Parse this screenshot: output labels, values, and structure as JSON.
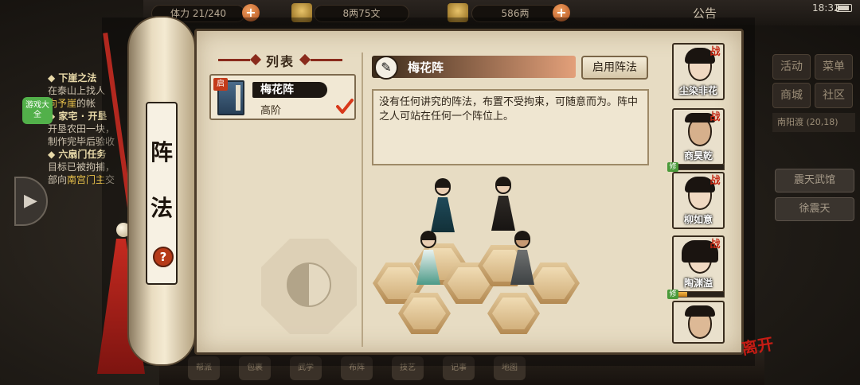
{
  "topbar": {
    "stamina_label": "体力",
    "stamina_value": "21/240",
    "silver": "8两75文",
    "gold": "586两",
    "notice_label": "公告",
    "clock": "18:32"
  },
  "quest_log": {
    "q1_title": "◆ 下崖之法",
    "q1_line1": "在泰山上找人",
    "q1_highlight": "向予崖",
    "q1_suffix": "的帐",
    "q2_title": "◆ 家宅 · 开垦",
    "q2_line1": "开垦农田一块，",
    "q2_line2": "制作完毕后验收",
    "q3_title": "◆ 六扇门任务",
    "q3_line1": "目标已被拘捕，",
    "q3_line2_prefix": "部向",
    "q3_highlight": "南宫门主",
    "q3_suffix": "交",
    "side_tab": "游戏大全"
  },
  "right_menu": {
    "activity": "活动",
    "menu": "菜单",
    "shop": "商城",
    "community": "社区",
    "location": "南阳渡",
    "coords": "(20,18)",
    "npc1": "震天武馆",
    "npc2": "徐震天"
  },
  "scroll": {
    "title_char1": "阵",
    "title_char2": "法",
    "help": "?"
  },
  "formation_list": {
    "header": "列表",
    "item": {
      "badge": "启",
      "name": "梅花阵",
      "rank": "高阶"
    }
  },
  "detail": {
    "name": "梅花阵",
    "enable_button": "启用阵法",
    "description": "没有任何讲究的阵法，布置不受拘束，可随意而为。阵中之人可站在任何一个阵位上。"
  },
  "party": [
    {
      "name": "尘染非花",
      "badge": "战"
    },
    {
      "name": "商昊乾",
      "badge": "战",
      "tag": "修",
      "progress": 0.12
    },
    {
      "name": "柳如意",
      "badge": "战"
    },
    {
      "name": "陶渊溢",
      "badge": "战",
      "tag": "修",
      "progress": 0.3
    },
    {
      "name": "",
      "badge": ""
    }
  ],
  "leave_stamp": "离开",
  "bottom_icons": [
    "帮派",
    "包裹",
    "武学",
    "布阵",
    "技艺",
    "记事",
    "地图"
  ]
}
